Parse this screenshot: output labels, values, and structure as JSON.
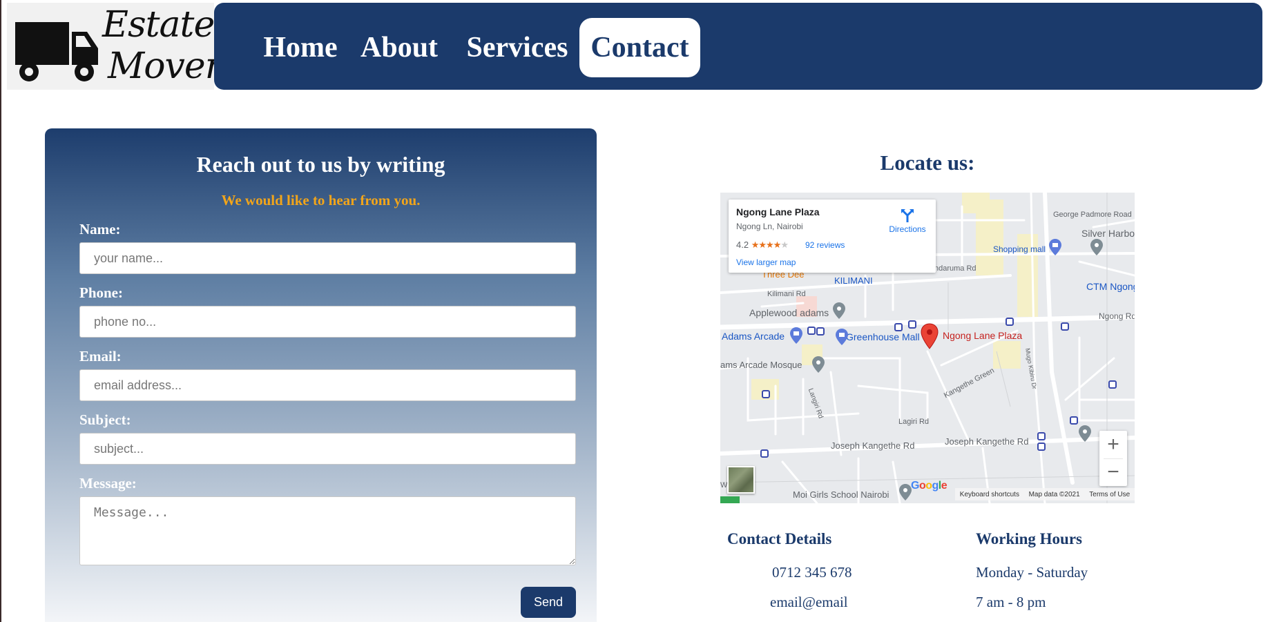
{
  "brand": {
    "logo_line1": "Estate",
    "logo_line2": "Movers"
  },
  "nav": {
    "items": [
      {
        "label": "Home"
      },
      {
        "label": "About"
      },
      {
        "label": "Services"
      },
      {
        "label": "Contact",
        "active": true
      }
    ]
  },
  "form": {
    "title": "Reach out to us by writing",
    "subtitle": "We would like to hear from you.",
    "fields": [
      {
        "label": "Name:",
        "placeholder": "your name...",
        "value": ""
      },
      {
        "label": "Phone:",
        "placeholder": "phone no...",
        "value": ""
      },
      {
        "label": "Email:",
        "placeholder": "email address...",
        "value": ""
      },
      {
        "label": "Subject:",
        "placeholder": "subject...",
        "value": ""
      },
      {
        "label": "Message:",
        "placeholder": "Message...",
        "value": ""
      }
    ],
    "send_label": "Send"
  },
  "locate": {
    "title": "Locate us:",
    "map": {
      "place_name": "Ngong Lane Plaza",
      "place_address": "Ngong Ln, Nairobi",
      "rating": "4.2",
      "stars": "★★★★",
      "star_off": "★",
      "reviews": "92 reviews",
      "directions": "Directions",
      "view_larger": "View larger map",
      "zoom_in": "+",
      "zoom_out": "−",
      "google": "Google",
      "keyboard_shortcuts": "Keyboard shortcuts",
      "map_data": "Map data ©2021",
      "terms": "Terms of Use",
      "labels": {
        "george_padmore": "George Padmore Road",
        "silver_harbor": "Silver Harbo",
        "shopping_mall": "Shopping mall",
        "ctm": "CTM Ngong",
        "ngong_rd": "Ngong Rd",
        "ndaruma": "ndaruma Rd",
        "kilimani": "KILIMANI",
        "kilimani_rd": "Kilimani Rd",
        "three_dee": "Three Dee",
        "applewood": "Applewood adams",
        "adams_arcade": "Adams Arcade",
        "greenhouse": "Greenhouse Mall",
        "ngong_lane_plaza": "Ngong Lane Plaza",
        "mosque": "ams Arcade Mosque",
        "kangethe_green": "Kangethe Green",
        "mugo_kibiru": "Mugo Kibiru Dr",
        "langiri": "Langiri Rd",
        "lagiri": "Lagiri Rd",
        "joseph_kangethe_1": "Joseph Kangethe Rd",
        "joseph_kangethe_2": "Joseph Kangethe Rd",
        "moi_girls": "Moi Girls School Nairobi",
        "war": "Wa"
      }
    }
  },
  "contact_details": {
    "heading": "Contact Details",
    "phone": "0712 345 678",
    "email": "email@email"
  },
  "working_hours": {
    "heading": "Working Hours",
    "days": "Monday - Saturday",
    "hours": "7 am - 8 pm"
  },
  "colors": {
    "navy": "#1b3a6b",
    "accent": "#f2a51a",
    "white": "#ffffff"
  }
}
